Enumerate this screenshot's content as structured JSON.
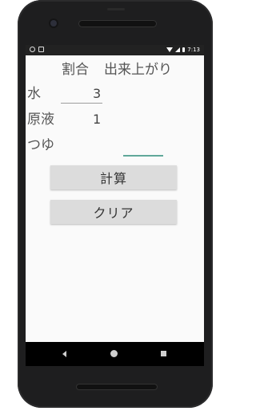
{
  "status_bar": {
    "time": "7:13"
  },
  "header": {
    "ratio": "割合",
    "result": "出来上がり"
  },
  "rows": {
    "water": {
      "label": "水",
      "value": "3"
    },
    "concentrate": {
      "label": "原液",
      "value": "1"
    },
    "tsuyu": {
      "label": "つゆ",
      "value": ""
    }
  },
  "buttons": {
    "calculate": "計算",
    "clear": "クリア"
  }
}
